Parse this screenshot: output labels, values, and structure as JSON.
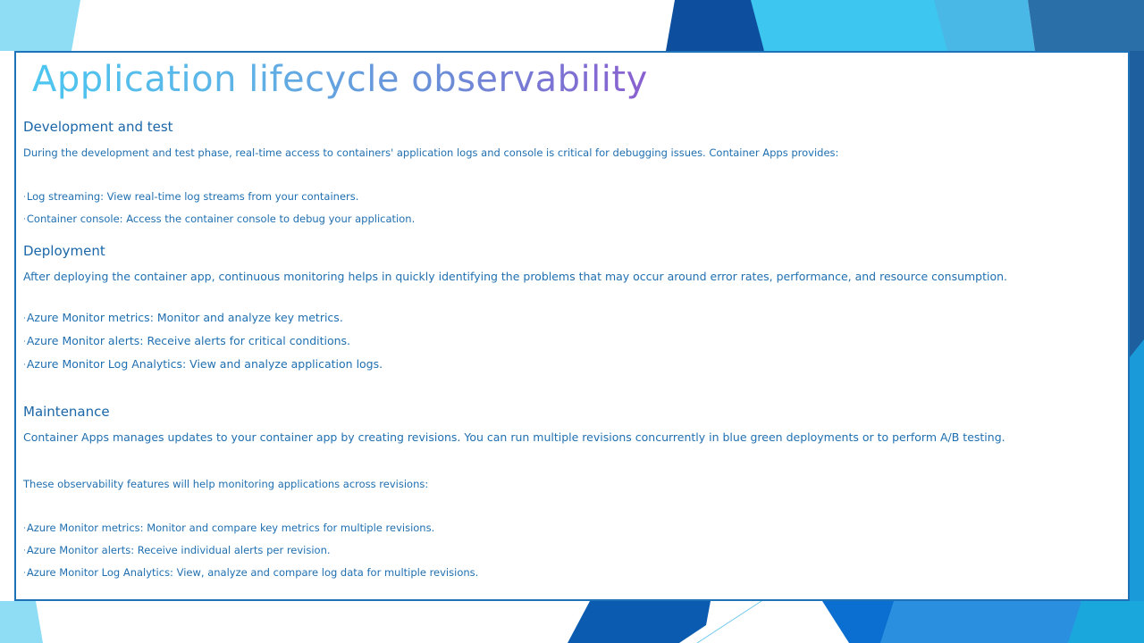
{
  "slide": {
    "title": "Application lifecycle observability",
    "sections": {
      "development": {
        "heading": "Development and test",
        "intro": "During the development and test phase, real-time access to containers' application logs and console is critical for debugging issues. Container Apps provides:",
        "bullets": [
          "Log streaming: View real-time log streams from your containers.",
          "Container console: Access the container console to debug your application."
        ]
      },
      "deployment": {
        "heading": "Deployment",
        "intro": "After deploying the container app, continuous monitoring helps in quickly identifying the problems that may occur around error rates, performance, and resource consumption.",
        "bullets": [
          "Azure Monitor metrics: Monitor and analyze key metrics.",
          "Azure Monitor alerts: Receive alerts for critical conditions.",
          "Azure Monitor Log Analytics: View and analyze application logs."
        ]
      },
      "maintenance": {
        "heading": "Maintenance",
        "intro": "Container Apps manages updates to your container app by creating revisions. You can run multiple revisions concurrently in blue green deployments or to perform A/B testing.",
        "note": "These observability features will help monitoring applications across revisions:",
        "bullets": [
          "Azure Monitor metrics: Monitor and compare key metrics for multiple revisions.",
          "Azure Monitor alerts: Receive individual alerts per revision.",
          "Azure Monitor Log Analytics: View, analyze and compare log data for multiple revisions."
        ]
      }
    },
    "bullet_glyph": "·"
  },
  "colors": {
    "text": "#1f6fb0",
    "heading": "#1a66a8",
    "border": "#1e73b8",
    "title_gradient_start": "#4cc6f0",
    "title_gradient_end": "#8a5fd0",
    "bg_light_blue": "#8fdcf5",
    "bg_cyan": "#3cc4ef",
    "bg_dark_blue": "#0b4fa0"
  }
}
